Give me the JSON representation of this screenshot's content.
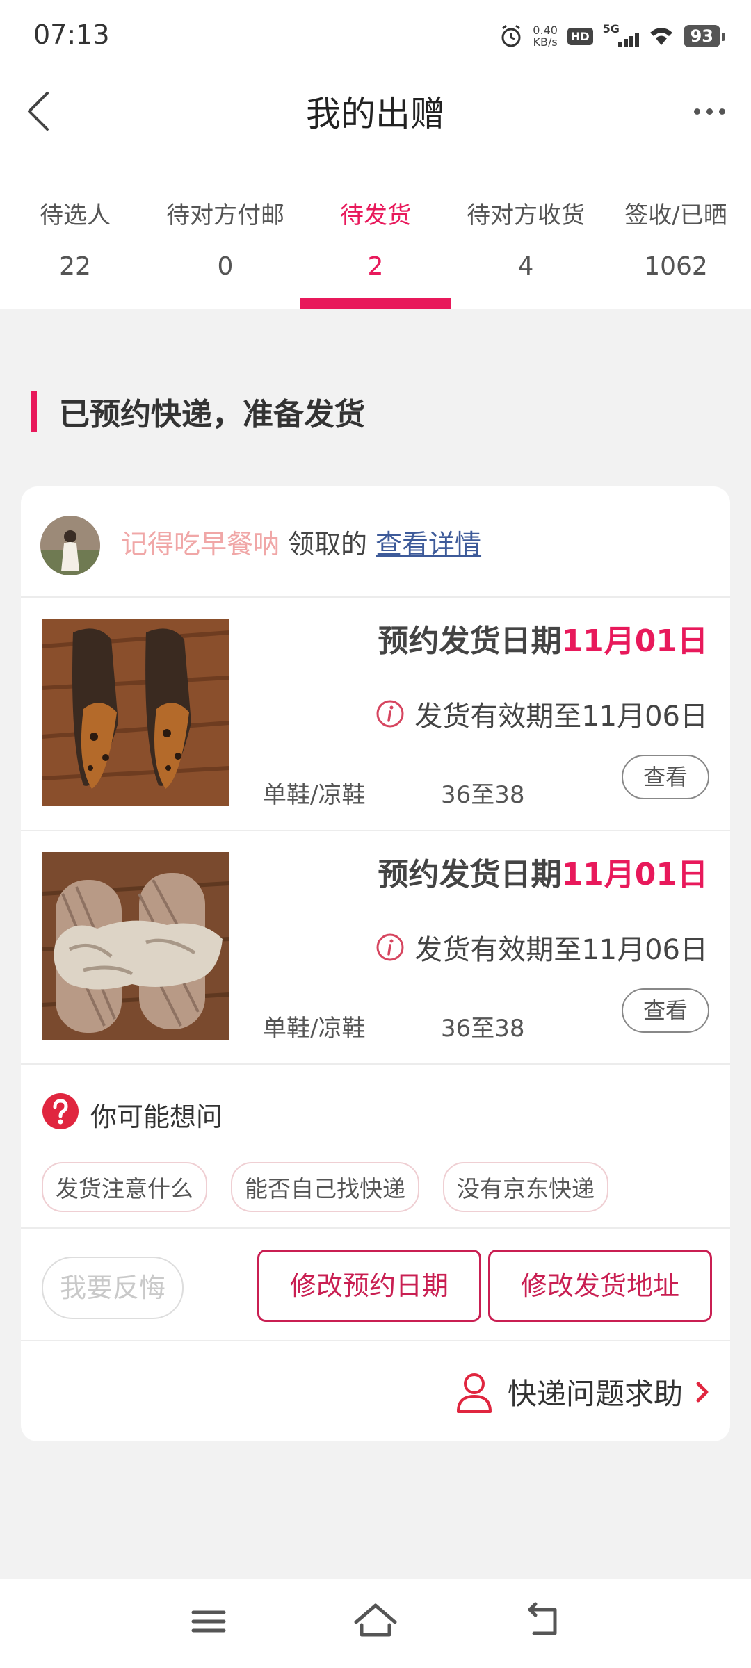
{
  "status_bar": {
    "time": "07:13",
    "net_speed_value": "0.40",
    "net_speed_unit": "KB/s",
    "hd": "HD",
    "network": "5G",
    "battery": "93"
  },
  "header": {
    "title": "我的出赠"
  },
  "tabs": [
    {
      "label": "待选人",
      "count": "22"
    },
    {
      "label": "待对方付邮",
      "count": "0"
    },
    {
      "label": "待发货",
      "count": "2"
    },
    {
      "label": "待对方收货",
      "count": "4"
    },
    {
      "label": "签收/已晒",
      "count": "1062"
    }
  ],
  "active_tab": "待发货",
  "section": {
    "title": "已预约快递，准备发货"
  },
  "card": {
    "user_name": "记得吃早餐呐",
    "claimed_text": "领取的",
    "detail_link": "查看详情",
    "items": [
      {
        "ship_label": "预约发货日期",
        "ship_date": "11月01日",
        "valid_text": "发货有效期至11月06日",
        "category": "单鞋/凉鞋",
        "size": "36至38",
        "view_label": "查看"
      },
      {
        "ship_label": "预约发货日期",
        "ship_date": "11月01日",
        "valid_text": "发货有效期至11月06日",
        "category": "单鞋/凉鞋",
        "size": "36至38",
        "view_label": "查看"
      }
    ],
    "faq": {
      "title": "你可能想问",
      "chips": [
        "发货注意什么",
        "能否自己找快递",
        "没有京东快递"
      ]
    },
    "actions": {
      "regret": "我要反悔",
      "change_date": "修改预约日期",
      "change_address": "修改发货地址"
    },
    "help": {
      "label": "快递问题求助"
    }
  },
  "colors": {
    "accent": "#e8195b",
    "button_red": "#c91f52",
    "link_blue": "#3d5a99",
    "username_pink": "#f0a7a7",
    "background": "#f2f2f2"
  },
  "icons": [
    "alarm-icon",
    "wifi-icon",
    "back-arrow-icon",
    "more-icon",
    "info-icon",
    "question-icon",
    "person-icon",
    "chevron-right-icon",
    "menu-icon",
    "home-icon",
    "return-icon"
  ]
}
